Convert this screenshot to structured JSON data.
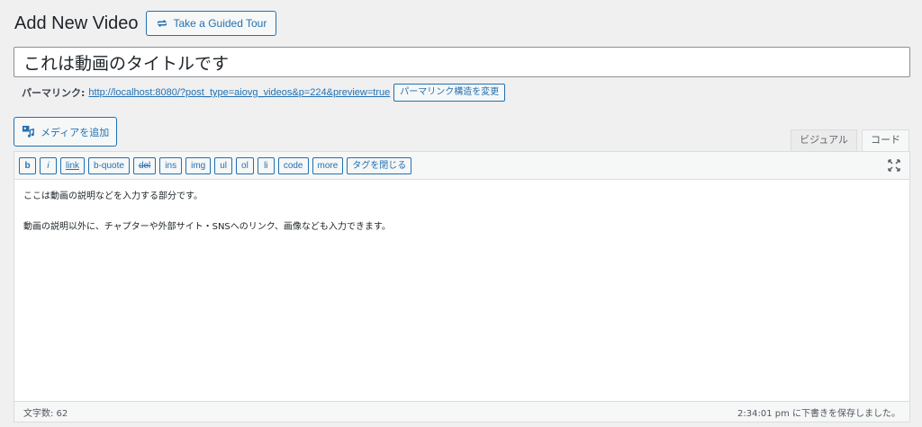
{
  "header": {
    "title": "Add New Video",
    "tour_label": "Take a Guided Tour"
  },
  "title_input": {
    "value": "これは動画のタイトルです"
  },
  "permalink": {
    "label": "パーマリンク:",
    "url": "http://localhost:8080/?post_type=aiovg_videos&p=224&preview=true",
    "change_label": "パーマリンク構造を変更"
  },
  "media": {
    "add_label": "メディアを追加"
  },
  "editor_tabs": [
    {
      "label": "ビジュアル"
    },
    {
      "label": "コード"
    }
  ],
  "quicktags": [
    "b",
    "i",
    "link",
    "b-quote",
    "del",
    "ins",
    "img",
    "ul",
    "ol",
    "li",
    "code",
    "more",
    "タグを閉じる"
  ],
  "content": {
    "line1": "ここは動画の説明などを入力する部分です。",
    "line2": "動画の説明以外に、チャプターや外部サイト・SNSへのリンク、画像なども入力できます。"
  },
  "status": {
    "word_count": "文字数: 62",
    "draft_saved": "2:34:01 pm に下書きを保存しました。"
  },
  "colors": {
    "accent": "#2271b1",
    "background": "#f0f0f1"
  }
}
